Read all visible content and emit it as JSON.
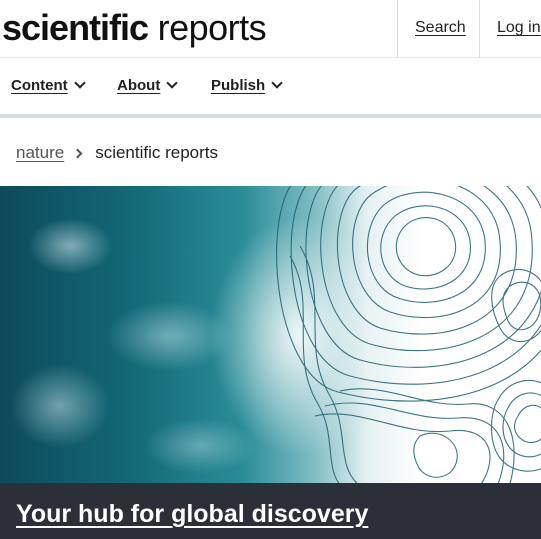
{
  "header": {
    "logo_bold": "scientific",
    "logo_light": "reports",
    "search_label": "Search",
    "login_label": "Log in"
  },
  "nav": {
    "items": [
      {
        "label": "Content"
      },
      {
        "label": "About"
      },
      {
        "label": "Publish"
      }
    ]
  },
  "breadcrumb": {
    "root": "nature",
    "current": "scientific reports"
  },
  "hero": {
    "image": "ocean-waves-with-contour-lines",
    "headline": "Your hub for global discovery"
  },
  "colors": {
    "banner_bg": "#2a2f38",
    "nav_border": "#d5dde6",
    "text": "#222222"
  }
}
